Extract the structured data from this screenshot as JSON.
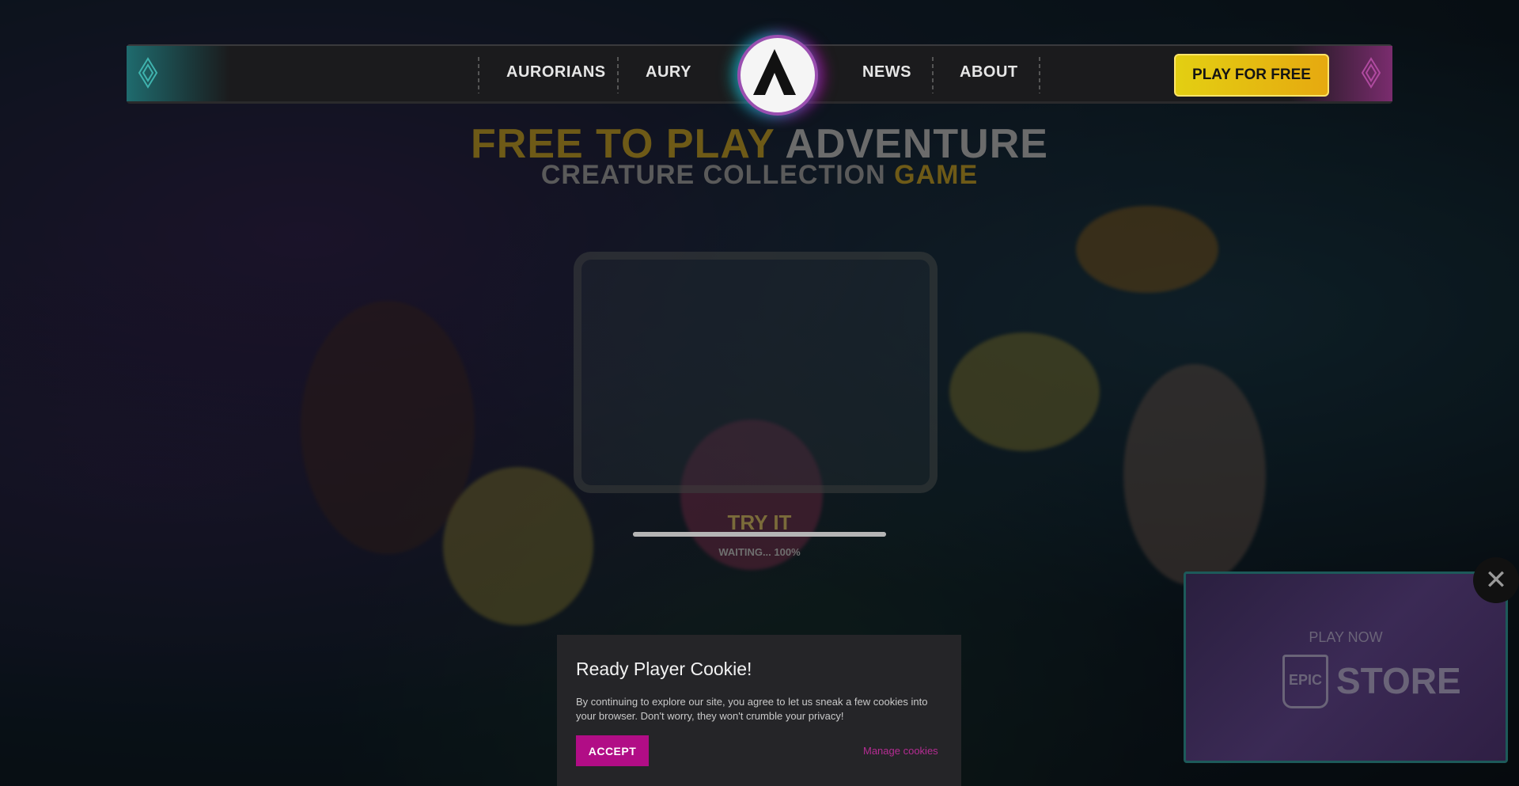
{
  "nav": {
    "items": [
      {
        "label": "AURORIANS"
      },
      {
        "label": "AURY"
      },
      {
        "label": "NEWS"
      },
      {
        "label": "ABOUT"
      }
    ],
    "logo_letter": "A",
    "play_button": "PLAY FOR FREE"
  },
  "hero": {
    "line1_highlight": "FREE TO PLAY",
    "line1_rest": "ADVENTURE",
    "line2_rest": "CREATURE COLLECTION",
    "line2_highlight": "GAME"
  },
  "tryit": {
    "label": "TRY IT",
    "progress_percent": 100,
    "waiting_text": "WAITING... 100%"
  },
  "epic_popup": {
    "play_now": "PLAY NOW",
    "epic_logo_text": "EPIC",
    "store_text": "STORE",
    "close_icon": "close-icon"
  },
  "cookie": {
    "title": "Ready Player Cookie!",
    "text": "By continuing to explore our site, you agree to let us sneak a few cookies into your browser. Don't worry, they won't crumble your privacy!",
    "accept": "ACCEPT",
    "manage": "Manage cookies"
  }
}
